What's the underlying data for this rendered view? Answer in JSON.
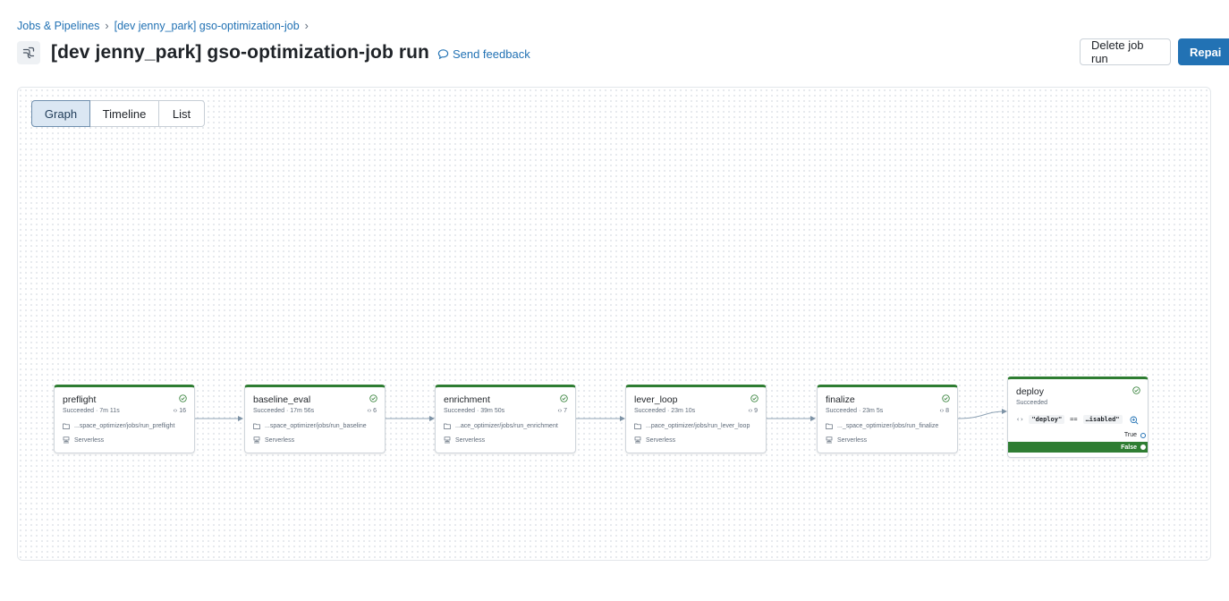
{
  "breadcrumb": {
    "items": [
      "Jobs & Pipelines",
      "[dev jenny_park] gso-optimization-job"
    ],
    "separator": "›"
  },
  "header": {
    "title": "[dev jenny_park] gso-optimization-job run",
    "feedback_label": "Send feedback",
    "delete_label": "Delete job run",
    "repair_label": "Repai"
  },
  "view_tabs": {
    "items": [
      "Graph",
      "Timeline",
      "List"
    ],
    "active": "Graph"
  },
  "colors": {
    "accent": "#2272b4",
    "success": "#2e7d32",
    "tab_active_bg": "#dbe7f3"
  },
  "tasks": [
    {
      "name": "preflight",
      "status": "Succeeded",
      "duration": "7m 11s",
      "count": "16",
      "path": "...space_optimizer/jobs/run_preflight",
      "compute": "Serverless",
      "status_icon": "check-circle-icon"
    },
    {
      "name": "baseline_eval",
      "status": "Succeeded",
      "duration": "17m 56s",
      "count": "6",
      "path": "...space_optimizer/jobs/run_baseline",
      "compute": "Serverless",
      "status_icon": "check-circle-icon"
    },
    {
      "name": "enrichment",
      "status": "Succeeded",
      "duration": "39m 50s",
      "count": "7",
      "path": "...ace_optimizer/jobs/run_enrichment",
      "compute": "Serverless",
      "status_icon": "check-circle-icon"
    },
    {
      "name": "lever_loop",
      "status": "Succeeded",
      "duration": "23m 10s",
      "count": "9",
      "path": "...pace_optimizer/jobs/run_lever_loop",
      "compute": "Serverless",
      "status_icon": "check-circle-icon"
    },
    {
      "name": "finalize",
      "status": "Succeeded",
      "duration": "23m 5s",
      "count": "8",
      "path": "..._space_optimizer/jobs/run_finalize",
      "compute": "Serverless",
      "status_icon": "check-circle-icon"
    }
  ],
  "deploy": {
    "name": "deploy",
    "status": "Succeeded",
    "left_operand": "\"deploy\"",
    "operator": "==",
    "right_operand": "…isabled\"",
    "true_label": "True",
    "false_label": "False"
  }
}
